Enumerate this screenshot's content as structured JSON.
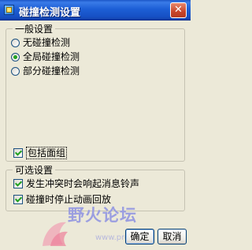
{
  "window": {
    "title": "碰撞检测设置",
    "close_glyph": "✕"
  },
  "general_group": {
    "legend": "一般设置",
    "options": [
      {
        "label": "无碰撞检测",
        "selected": false
      },
      {
        "label": "全局碰撞检测",
        "selected": true
      },
      {
        "label": "部分碰撞检测",
        "selected": false
      }
    ],
    "include_faces": {
      "label": "包括面组",
      "checked": true
    }
  },
  "optional_group": {
    "legend": "可选设置",
    "ring_bell": {
      "label": "发生冲突时会响起消息铃声",
      "checked": true
    },
    "stop_animation": {
      "label": "碰撞时停止动画回放",
      "checked": true
    }
  },
  "buttons": {
    "ok": "确定",
    "cancel": "取消"
  },
  "watermark": {
    "text": "野火论坛",
    "url_fragment": "www.pro"
  },
  "colors": {
    "titlebar": "#1d5fd6",
    "dialog_bg": "#ece9d8",
    "check_mark": "#21a121"
  }
}
